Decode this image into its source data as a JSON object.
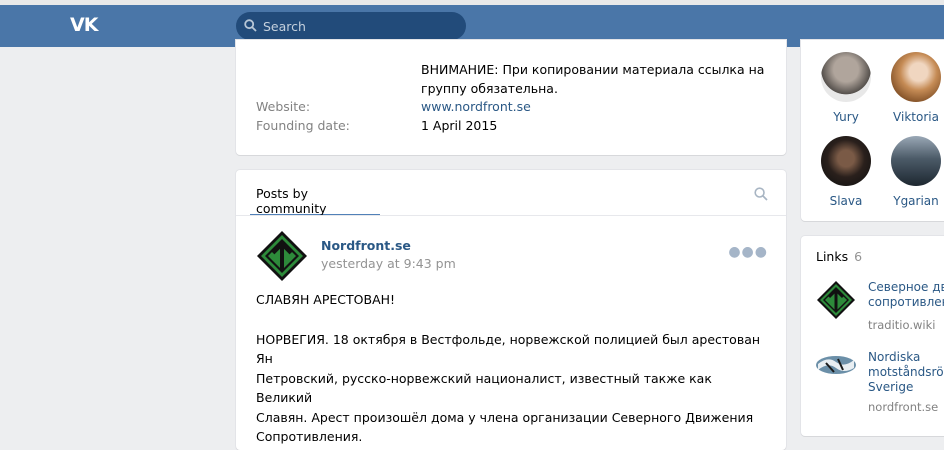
{
  "header": {
    "logo": "VK",
    "search_placeholder": "Search"
  },
  "info": {
    "description_line1": "ВНИМАНИЕ: При копировании материала ссылка на",
    "description_line2": "группу обязательна.",
    "website_label": "Website:",
    "website_value": "www.nordfront.se",
    "founding_label": "Founding date:",
    "founding_value": "1 April 2015"
  },
  "posts": {
    "tab_label": "Posts by community",
    "post": {
      "author": "Nordfront.se",
      "time": "yesterday at 9:43 pm",
      "paragraph1": "СЛАВЯН АРЕСТОВАН!",
      "paragraph2_line1": "НОРВЕГИЯ. 18 октября в Вестфольде, норвежской полицией был арестован Ян",
      "paragraph2_line2": "Петровский, русско-норвежский националист, известный также как Великий",
      "paragraph2_line3": "Славян. Арест произошёл дома у члена организации Северного Движения",
      "paragraph2_line4": "Сопротивления."
    }
  },
  "members": [
    {
      "name": "Yury"
    },
    {
      "name": "Viktoria"
    },
    {
      "name": "Slava"
    },
    {
      "name": "Ygarian"
    }
  ],
  "links": {
    "title": "Links",
    "count": "6",
    "items": [
      {
        "title_line1": "Северное дви",
        "title_line2": "сопротивлен",
        "sub": "traditio.wiki"
      },
      {
        "title_line1": "Nordiska",
        "title_line2": "motståndsrör",
        "title_line3": "Sverige",
        "sub": "nordfront.se"
      }
    ]
  },
  "colors": {
    "header": "#4a76a8",
    "link": "#2a5885",
    "accent_tab": "#5181b8"
  }
}
